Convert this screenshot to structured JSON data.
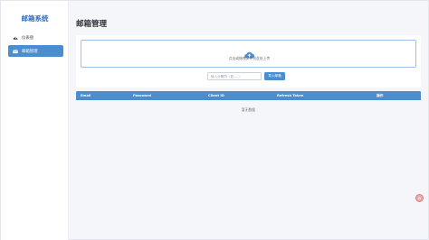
{
  "sidebar": {
    "brand": "邮箱系统",
    "items": [
      {
        "label": "仪表盘",
        "icon": "dashboard-icon",
        "active": false
      },
      {
        "label": "邮箱管理",
        "icon": "envelope-icon",
        "active": true
      }
    ]
  },
  "main": {
    "title": "邮箱管理",
    "upload": {
      "icon": "cloud-upload-icon",
      "text": "点击或拖拽文件到此处上传"
    },
    "search": {
      "placeholder": "输入分隔符（如----）",
      "button_label": "导入邮箱"
    },
    "table": {
      "columns": [
        "Email",
        "Password",
        "Client ID",
        "Refresh Token",
        "操作"
      ],
      "rows": [],
      "empty_text": "暂无数据"
    }
  },
  "colors": {
    "accent": "#4a8ed0",
    "brand": "#2f6fc0",
    "background": "#f4f6fa"
  }
}
